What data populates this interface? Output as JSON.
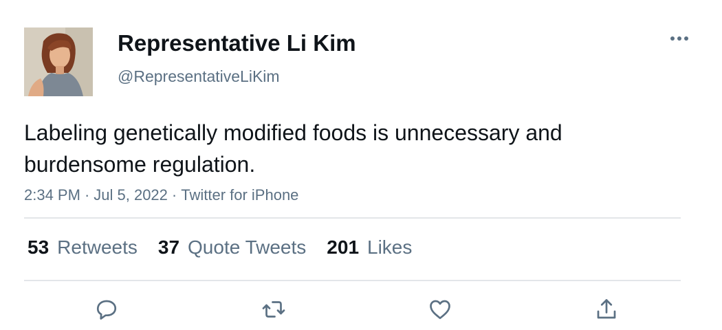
{
  "author": {
    "display_name": "Representative Li Kim",
    "handle": "@RepresentativeLiKim",
    "avatar_icon": "profile-photo"
  },
  "tweet": {
    "text": "Labeling genetically modified foods is unnecessary and burdensome regulation.",
    "time": "2:34 PM",
    "date": "Jul 5, 2022",
    "source": "Twitter for iPhone",
    "separator": "·"
  },
  "stats": {
    "retweets": {
      "count": "53",
      "label": "Retweets"
    },
    "quote_tweets": {
      "count": "37",
      "label": "Quote Tweets"
    },
    "likes": {
      "count": "201",
      "label": "Likes"
    }
  },
  "actions": {
    "reply_icon": "reply-icon",
    "retweet_icon": "retweet-icon",
    "like_icon": "heart-icon",
    "share_icon": "share-icon"
  },
  "colors": {
    "text_primary": "#0f1419",
    "text_secondary": "#5b7083",
    "divider": "#e3e6e9"
  }
}
